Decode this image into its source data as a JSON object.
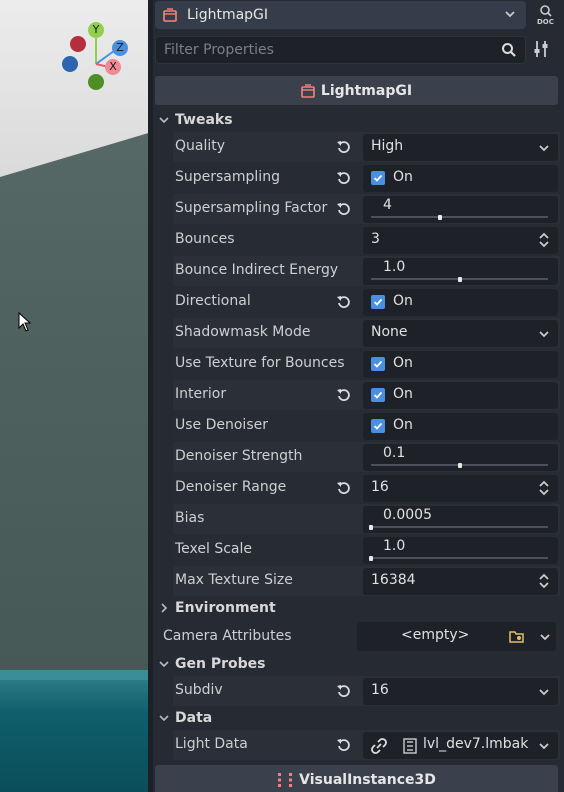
{
  "viewport": {
    "gizmo": {
      "y": "Y",
      "z": "Z",
      "x": "X"
    }
  },
  "inspector": {
    "object_name": "LightmapGI",
    "filter_placeholder": "Filter Properties",
    "class_header": "LightmapGI",
    "sections": {
      "tweaks": "Tweaks",
      "environment": "Environment",
      "gen_probes": "Gen Probes",
      "data": "Data"
    },
    "props": {
      "quality": {
        "label": "Quality",
        "value": "High"
      },
      "supersampling": {
        "label": "Supersampling",
        "value": "On"
      },
      "supersampling_factor": {
        "label": "Supersampling Factor",
        "value": "4",
        "fraction": 0.39
      },
      "bounces": {
        "label": "Bounces",
        "value": "3"
      },
      "bounce_indirect_energy": {
        "label": "Bounce Indirect Energy",
        "value": "1.0",
        "fraction": 0.5
      },
      "directional": {
        "label": "Directional",
        "value": "On"
      },
      "shadowmask_mode": {
        "label": "Shadowmask Mode",
        "value": "None"
      },
      "use_texture_for_bounces": {
        "label": "Use Texture for Bounces",
        "value": "On"
      },
      "interior": {
        "label": "Interior",
        "value": "On"
      },
      "use_denoiser": {
        "label": "Use Denoiser",
        "value": "On"
      },
      "denoiser_strength": {
        "label": "Denoiser Strength",
        "value": "0.1",
        "fraction": 0.5
      },
      "denoiser_range": {
        "label": "Denoiser Range",
        "value": "16"
      },
      "bias": {
        "label": "Bias",
        "value": "0.0005",
        "fraction": 0.0
      },
      "texel_scale": {
        "label": "Texel Scale",
        "value": "1.0",
        "fraction": 0.0
      },
      "max_texture_size": {
        "label": "Max Texture Size",
        "value": "16384"
      },
      "camera_attributes": {
        "label": "Camera Attributes",
        "value": "<empty>"
      },
      "subdiv": {
        "label": "Subdiv",
        "value": "16"
      },
      "light_data": {
        "label": "Light Data",
        "value": "lvl_dev7.lmbak"
      }
    },
    "bottom_header": "VisualInstance3D",
    "colors": {
      "accent": "#4b8fe0",
      "node_icon": "#fc7f7f"
    }
  }
}
